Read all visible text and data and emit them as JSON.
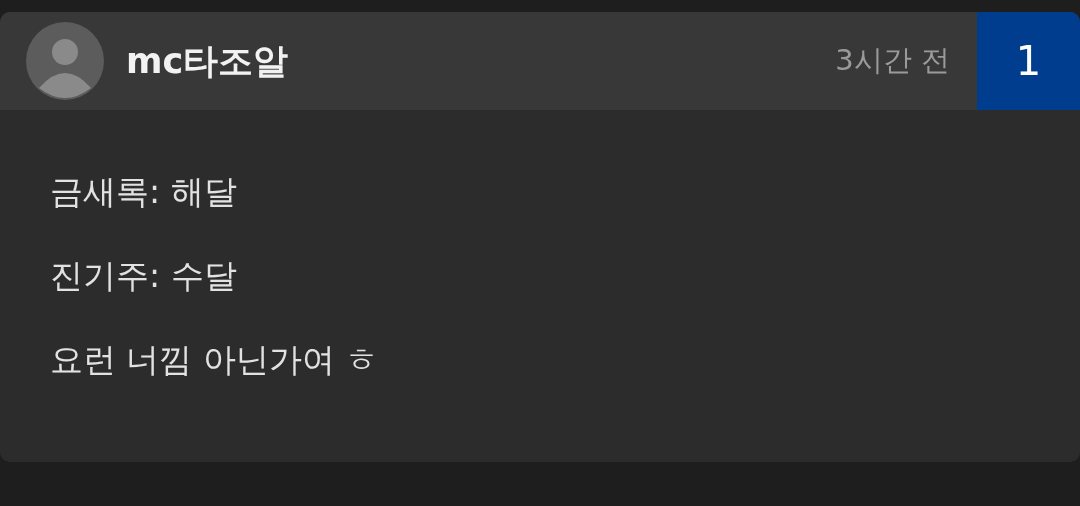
{
  "comment": {
    "author": "mc타조알",
    "time": "3시간 전",
    "number": "1",
    "lines": [
      "금새록: 해달",
      "진기주: 수달",
      "요런 너낌 아닌가여 ㅎ"
    ]
  }
}
